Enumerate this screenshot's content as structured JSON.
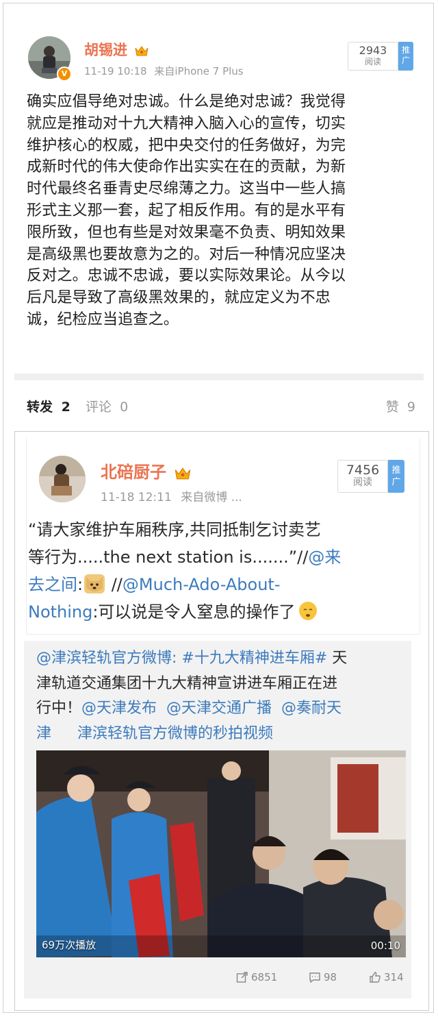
{
  "post": {
    "username": "胡锡进",
    "timestamp": "11-19 10:18",
    "source": "来自iPhone 7 Plus",
    "read_count": "2943",
    "read_label": "阅读",
    "promote_label": "推广",
    "body_lines": [
      "确实应倡导绝对忠诚。什么是绝对忠诚？我觉得",
      "就应是推动对十九大精神入脑入心的宣传，切实",
      "维护核心的权威，把中央交付的任务做好，为完",
      "成新时代的伟大使命作出实实在在的贡献，为新",
      "时代最终名垂青史尽绵薄之力。这当中一些人搞",
      "形式主义那一套，起了相反作用。有的是水平有",
      "限所致，但也有些是对效果毫不负责、明知效果",
      "是高级黑也要故意为之的。对后一种情况应坚决",
      "反对之。忠诚不忠诚，要以实际效果论。从今以",
      "后凡是导致了高级黑效果的，就应定义为不忠",
      "诚，纪检应当追查之。"
    ]
  },
  "tabs": {
    "repost_label": "转发",
    "repost_count": "2",
    "comment_label": "评论",
    "comment_count": "0",
    "like_label": "赞",
    "like_count": "9"
  },
  "repost": {
    "username": "北碚厨子",
    "timestamp": "11-18 12:11",
    "source": "来自微博 ...",
    "read_count": "7456",
    "read_label": "阅读",
    "promote_label": "推广",
    "line1": "“请大家维护车厢秩序,共同抵制乞讨卖艺",
    "line2_text": "等行为.....the next station is.......”//",
    "line2_mention": "@来",
    "line3_mention": "去之间",
    "line3_sep": ":",
    "line3_slash": " //",
    "line3_mention2": "@Much-Ado-About-",
    "line4_mention": "Nothing",
    "line4_text": ":可以说是令人窒息的操作了"
  },
  "quoted": {
    "line1_mention": "@津滨轻轨官方微博",
    "line1_sep": ": ",
    "line1_topic": "#十九大精神进车厢#",
    "line1_text": " 天",
    "line2": "津轨道交通集团十九大精神宣讲进车厢正在进",
    "line3_text": "行中！",
    "line3_m1": "@天津发布",
    "line3_m2": "@天津交通广播",
    "line3_m3": "@奏耐天",
    "line4_m": "津",
    "line4_link": "津滨轻轨官方微博的秒拍视频",
    "video_plays": "69万次播放",
    "video_duration": "00:10",
    "share_count": "6851",
    "comment_count": "98",
    "like_count": "314"
  },
  "colors": {
    "username": "#eb7350",
    "link": "#3c7bbd",
    "promo": "#61a7e8",
    "vip": "#f29100"
  }
}
